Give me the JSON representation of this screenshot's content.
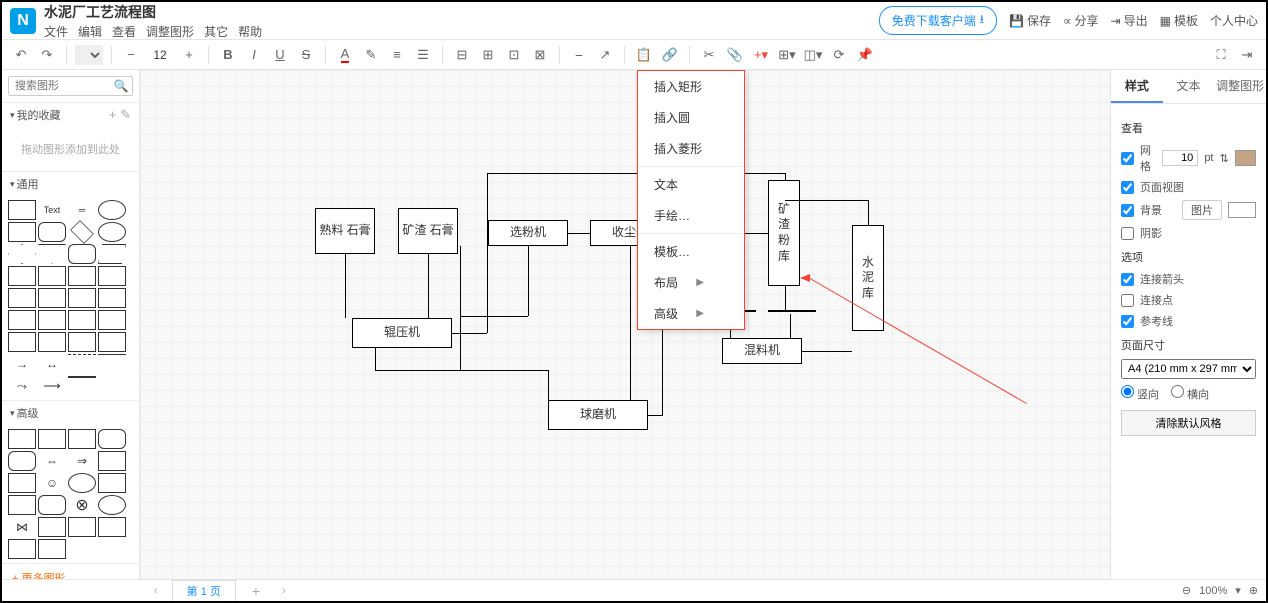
{
  "header": {
    "doc_title": "水泥厂工艺流程图",
    "menu": [
      "文件",
      "编辑",
      "查看",
      "调整图形",
      "其它",
      "帮助"
    ],
    "download_btn": "免费下载客户端",
    "actions": {
      "save": "保存",
      "share": "分享",
      "export": "导出",
      "template": "模板",
      "profile": "个人中心"
    }
  },
  "toolbar": {
    "font": "Arial",
    "font_size": "12",
    "bold": "B",
    "italic": "I",
    "underline": "U",
    "strike": "S"
  },
  "left": {
    "search_placeholder": "搜索图形",
    "favorites": "我的收藏",
    "fav_hint": "拖动图形添加到此处",
    "general": "通用",
    "advanced": "高级",
    "more": "+ 更多图形…"
  },
  "context_menu": {
    "insert_rect": "插入矩形",
    "insert_circle": "插入圆",
    "insert_diamond": "插入菱形",
    "text": "文本",
    "freehand": "手绘…",
    "template": "模板…",
    "layout": "布局",
    "advanced": "高级"
  },
  "shapes": {
    "box1": "熟料\n石膏",
    "box2": "矿渣\n石膏",
    "box3": "选粉机",
    "box4": "收尘器",
    "box5": "矿渣粉库",
    "box6": "水泥库",
    "box7": "辊压机",
    "box8": "混料机",
    "box9": "球磨机"
  },
  "right": {
    "tab_style": "样式",
    "tab_text": "文本",
    "tab_adjust": "调整图形",
    "view": "查看",
    "grid": "网格",
    "grid_val": "10",
    "grid_unit": "pt",
    "page_view": "页面视图",
    "background": "背景",
    "image_btn": "图片",
    "shadow": "阴影",
    "options": "选项",
    "conn_arrow": "连接箭头",
    "conn_point": "连接点",
    "guides": "参考线",
    "page_size": "页面尺寸",
    "size_value": "A4 (210 mm x 297 mm)",
    "portrait": "竖向",
    "landscape": "横向",
    "clear_default": "清除默认风格"
  },
  "status": {
    "page_tab": "第 1 页",
    "zoom": "100%"
  }
}
